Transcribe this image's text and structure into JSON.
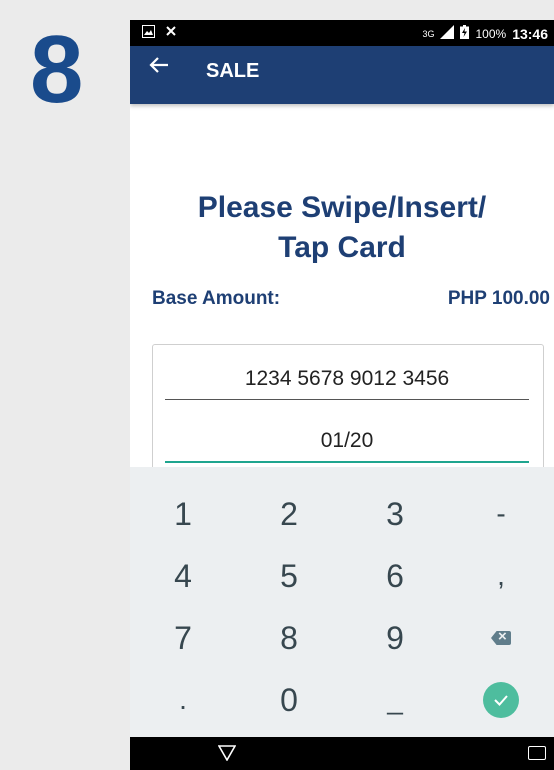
{
  "step_number": "8",
  "status_bar": {
    "network": "3G",
    "battery": "100%",
    "time": "13:46"
  },
  "app_bar": {
    "title": "SALE"
  },
  "prompt": {
    "line1": "Please Swipe/Insert/",
    "line2": "Tap Card"
  },
  "amount": {
    "label": "Base Amount:",
    "value": "PHP 100.00"
  },
  "card_form": {
    "card_number": "1234 5678 9012 3456",
    "expiry": "01/20"
  },
  "keyboard": {
    "keys": [
      "1",
      "2",
      "3",
      "-",
      "4",
      "5",
      "6",
      ",",
      "7",
      "8",
      "9",
      "backspace",
      ".",
      "0",
      "_",
      "enter"
    ]
  },
  "colors": {
    "primary": "#1e3f74",
    "accent": "#1fa58f",
    "step_number": "#1a4b8c"
  }
}
